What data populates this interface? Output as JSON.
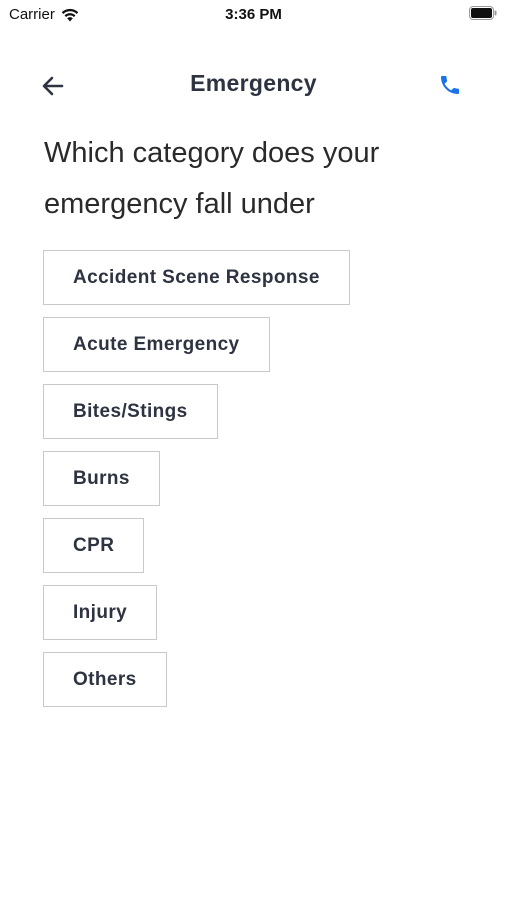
{
  "status_bar": {
    "carrier": "Carrier",
    "time": "3:36 PM"
  },
  "header": {
    "title": "Emergency",
    "back_icon": "arrow-left-icon",
    "call_icon": "phone-icon"
  },
  "question": "Which category does your emergency fall under",
  "categories": [
    {
      "label": "Accident Scene Response"
    },
    {
      "label": "Acute Emergency"
    },
    {
      "label": "Bites/Stings"
    },
    {
      "label": "Burns"
    },
    {
      "label": "CPR"
    },
    {
      "label": "Injury"
    },
    {
      "label": "Others"
    }
  ],
  "colors": {
    "accent": "#1a73e8",
    "text": "#2d3340",
    "border": "#c9c9c9"
  }
}
